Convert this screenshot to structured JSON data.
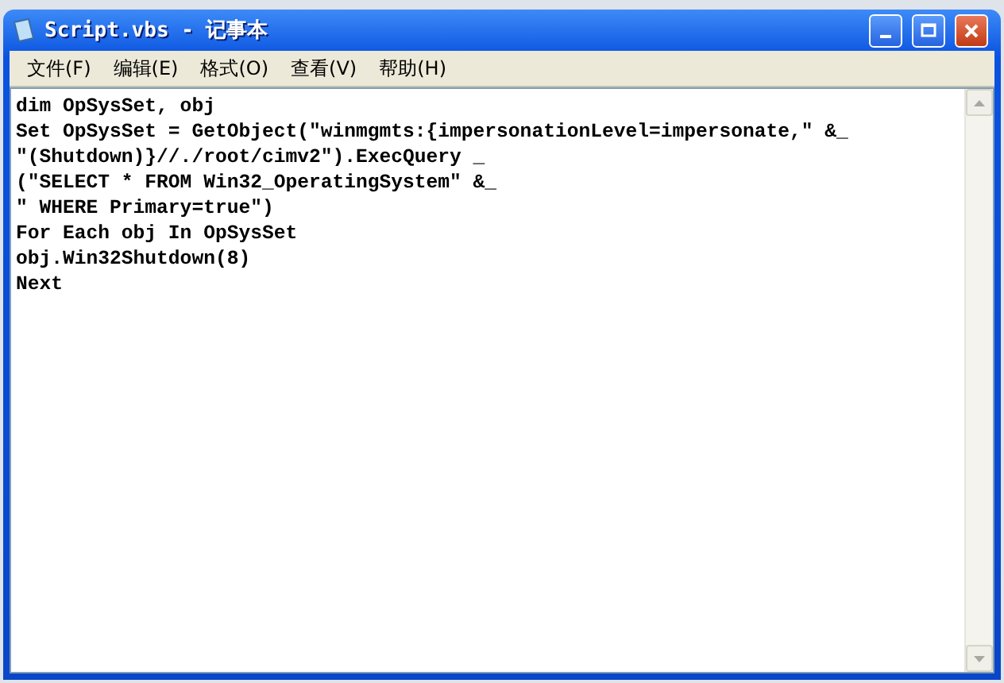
{
  "window": {
    "title": "Script.vbs - 记事本"
  },
  "menu": [
    "文件(F)",
    "编辑(E)",
    "格式(O)",
    "查看(V)",
    "帮助(H)"
  ],
  "editor": {
    "lines": [
      "dim OpSysSet, obj",
      "Set OpSysSet = GetObject(\"winmgmts:{impersonationLevel=impersonate,\" &_",
      "\"(Shutdown)}//./root/cimv2\").ExecQuery _",
      "(\"SELECT * FROM Win32_OperatingSystem\" &_",
      "\" WHERE Primary=true\")",
      "For Each obj In OpSysSet",
      "obj.Win32Shutdown(8)",
      "Next"
    ]
  }
}
